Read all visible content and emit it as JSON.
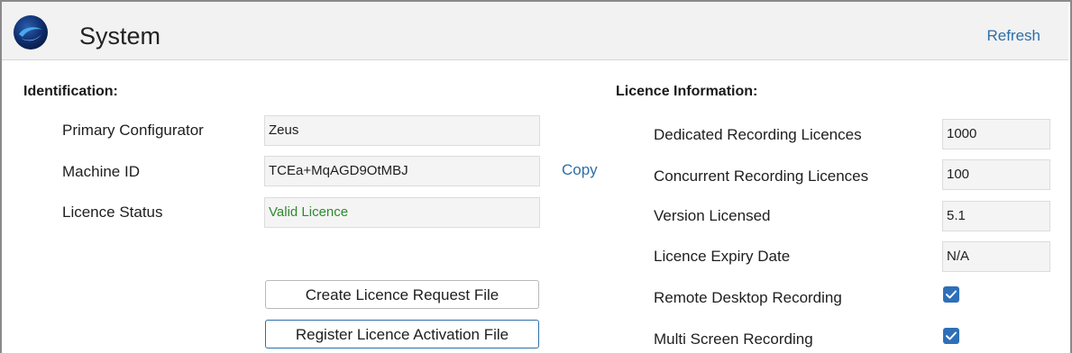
{
  "header": {
    "title": "System",
    "refresh_label": "Refresh"
  },
  "identification": {
    "section_title": "Identification:",
    "primary_configurator": {
      "label": "Primary Configurator",
      "value": "Zeus"
    },
    "machine_id": {
      "label": "Machine ID",
      "value": "TCEa+MqAGD9OtMBJ"
    },
    "licence_status": {
      "label": "Licence Status",
      "value": "Valid Licence"
    },
    "copy_label": "Copy",
    "create_request_button": "Create Licence Request File",
    "register_activation_button": "Register Licence Activation File"
  },
  "licence_info": {
    "section_title": "Licence Information:",
    "dedicated": {
      "label": "Dedicated Recording Licences",
      "value": "1000"
    },
    "concurrent": {
      "label": "Concurrent Recording Licences",
      "value": "100"
    },
    "version": {
      "label": "Version Licensed",
      "value": "5.1"
    },
    "expiry": {
      "label": "Licence Expiry Date",
      "value": "N/A"
    },
    "remote_desktop": {
      "label": "Remote Desktop Recording",
      "checked": true
    },
    "multi_screen": {
      "label": "Multi Screen Recording",
      "checked": true
    }
  },
  "colors": {
    "accent": "#2e6fa8",
    "valid_text": "#2f8a2f",
    "checkbox_fill": "#2e6fb8"
  },
  "icons": {
    "logo": "app-logo-icon",
    "checkbox": "checkbox-checked-icon"
  }
}
